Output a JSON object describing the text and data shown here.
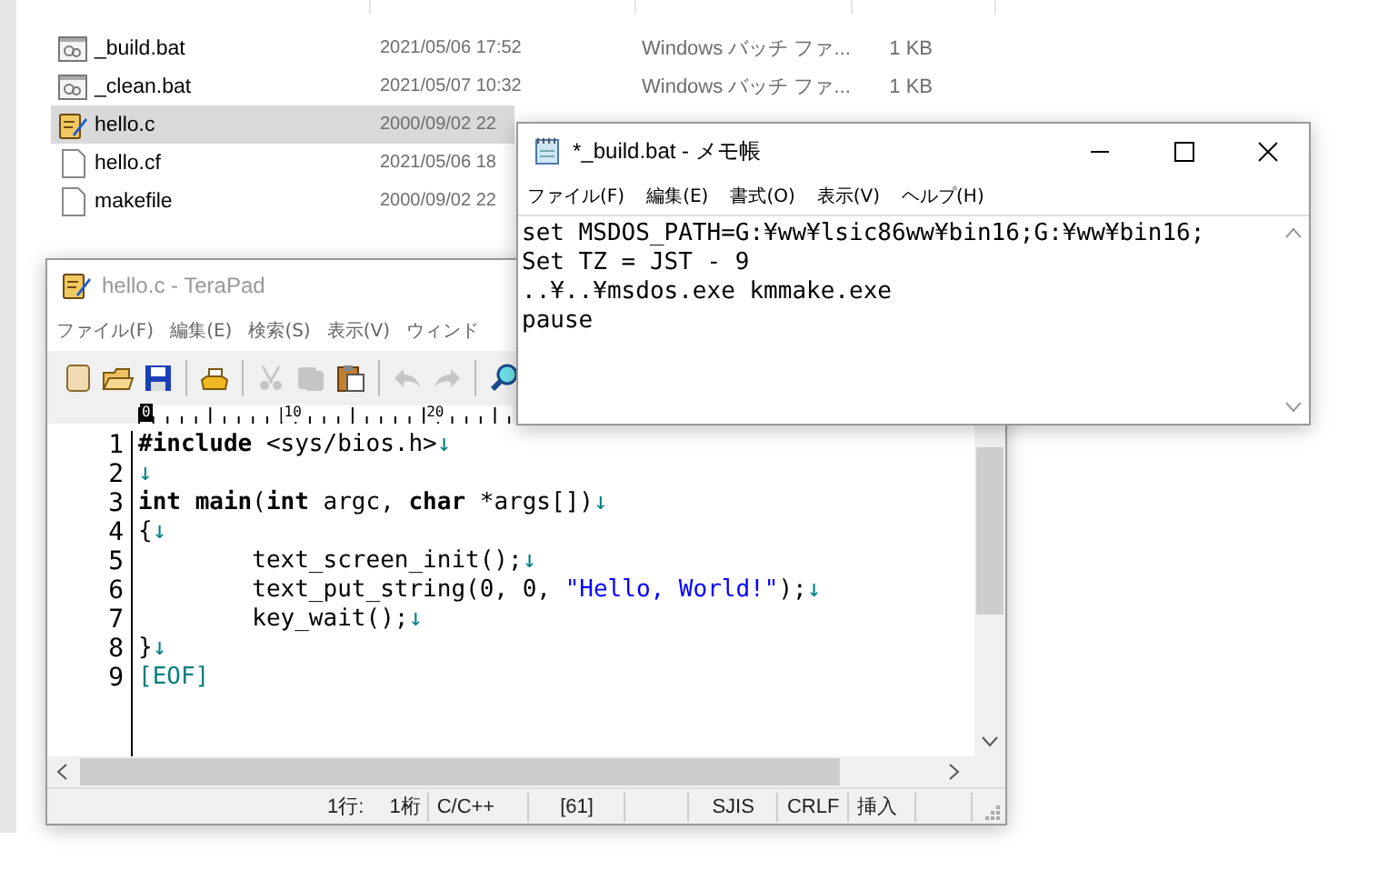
{
  "explorer": {
    "files": [
      {
        "kind": "batch",
        "name": "_build.bat",
        "modified": "2021/05/06 17:52",
        "type": "Windows バッチ ファ...",
        "size": "1 KB",
        "selected": false
      },
      {
        "kind": "batch",
        "name": "_clean.bat",
        "modified": "2021/05/07 10:32",
        "type": "Windows バッチ ファ...",
        "size": "1 KB",
        "selected": false
      },
      {
        "kind": "source",
        "name": "hello.c",
        "modified": "2000/09/02 22",
        "selected": true
      },
      {
        "kind": "plain",
        "name": "hello.cf",
        "modified": "2021/05/06 18",
        "selected": false
      },
      {
        "kind": "plain",
        "name": "makefile",
        "modified": "2000/09/02 22",
        "selected": false
      }
    ]
  },
  "terapad": {
    "title": "hello.c - TeraPad",
    "menu": [
      "ファイル(F)",
      "編集(E)",
      "検索(S)",
      "表示(V)",
      "ウィンド"
    ],
    "toolbar": [
      {
        "kind": "new",
        "disabled": false
      },
      {
        "kind": "open",
        "disabled": false
      },
      {
        "kind": "save",
        "disabled": false
      },
      {
        "kind": "separator"
      },
      {
        "kind": "print",
        "disabled": false
      },
      {
        "kind": "separator"
      },
      {
        "kind": "cut",
        "disabled": true
      },
      {
        "kind": "copy",
        "disabled": true
      },
      {
        "kind": "paste",
        "disabled": false
      },
      {
        "kind": "separator"
      },
      {
        "kind": "undo",
        "disabled": true
      },
      {
        "kind": "redo",
        "disabled": true
      },
      {
        "kind": "separator"
      },
      {
        "kind": "search",
        "disabled": false
      }
    ],
    "ruler": [
      "0",
      "10",
      "20"
    ],
    "lines": [
      {
        "number": "1",
        "segments": [
          {
            "kind": "keyword",
            "text": "#include"
          },
          {
            "kind": "plain",
            "text": " <sys/bios.h>"
          },
          {
            "kind": "eol",
            "text": "↓"
          }
        ]
      },
      {
        "number": "2",
        "segments": [
          {
            "kind": "eol",
            "text": "↓"
          }
        ]
      },
      {
        "number": "3",
        "segments": [
          {
            "kind": "keyword",
            "text": "int "
          },
          {
            "kind": "keyword",
            "text": "main"
          },
          {
            "kind": "plain",
            "text": "("
          },
          {
            "kind": "keyword",
            "text": "int"
          },
          {
            "kind": "plain",
            "text": " argc, "
          },
          {
            "kind": "keyword",
            "text": "char"
          },
          {
            "kind": "plain",
            "text": " *args[])"
          },
          {
            "kind": "eol",
            "text": "↓"
          }
        ]
      },
      {
        "number": "4",
        "segments": [
          {
            "kind": "plain",
            "text": "{"
          },
          {
            "kind": "eol",
            "text": "↓"
          }
        ]
      },
      {
        "number": "5",
        "segments": [
          {
            "kind": "plain",
            "text": "\ttext_screen_init();"
          },
          {
            "kind": "eol",
            "text": "↓"
          }
        ]
      },
      {
        "number": "6",
        "segments": [
          {
            "kind": "plain",
            "text": "\ttext_put_string(0, 0, "
          },
          {
            "kind": "string",
            "text": "\"Hello, World!\""
          },
          {
            "kind": "plain",
            "text": ");"
          },
          {
            "kind": "eol",
            "text": "↓"
          }
        ]
      },
      {
        "number": "7",
        "segments": [
          {
            "kind": "plain",
            "text": "\tkey_wait();"
          },
          {
            "kind": "eol",
            "text": "↓"
          }
        ]
      },
      {
        "number": "8",
        "segments": [
          {
            "kind": "plain",
            "text": "}"
          },
          {
            "kind": "eol",
            "text": "↓"
          }
        ]
      },
      {
        "number": "9",
        "segments": [
          {
            "kind": "eof",
            "text": "[EOF]"
          }
        ]
      }
    ],
    "status": [
      "1行:",
      "1桁",
      "C/C++",
      "[61]",
      "SJIS",
      "CRLF",
      "挿入"
    ]
  },
  "notepad": {
    "title": "*_build.bat - メモ帳",
    "menu": [
      "ファイル(F)",
      "編集(E)",
      "書式(O)",
      "表示(V)",
      "ヘルプ(H)"
    ],
    "lines": [
      "set MSDOS_PATH=G:¥ww¥lsic86ww¥bin16;G:¥ww¥bin16;",
      "Set TZ = JST - 9",
      "..¥..¥msdos.exe kmmake.exe",
      "pause"
    ]
  }
}
